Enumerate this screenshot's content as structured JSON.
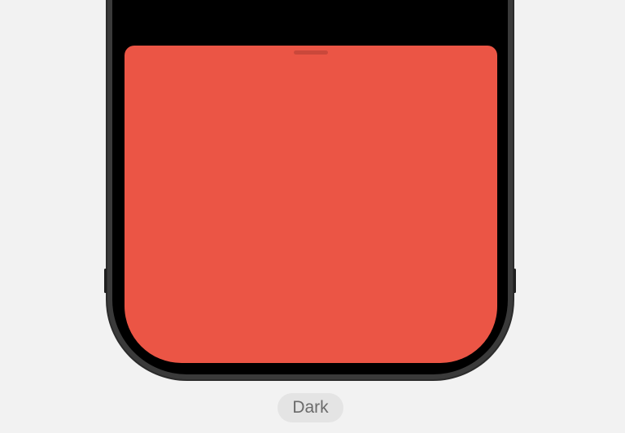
{
  "appearance": {
    "mode_label": "Dark"
  },
  "colors": {
    "page_background": "#f2f2f2",
    "device_frame": "#2b2b2b",
    "device_screen": "#000000",
    "sheet_fill": "#EB5545",
    "badge_background": "#e4e4e4",
    "badge_text": "#6b6b6b"
  }
}
